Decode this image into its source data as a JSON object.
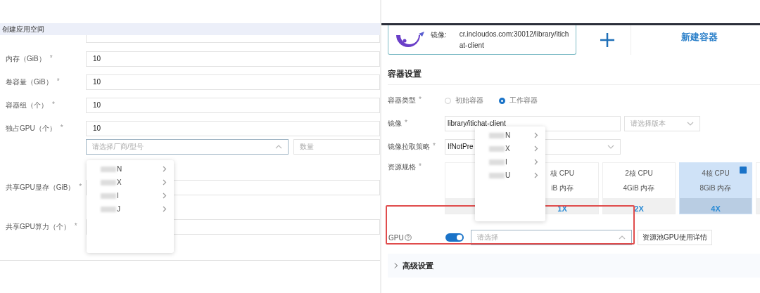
{
  "left": {
    "title": "创建应用空间",
    "fields": [
      {
        "label": "内存（GiB）",
        "asterisk": "*",
        "value": "10"
      },
      {
        "label": "卷容量（GiB）",
        "asterisk": "*",
        "value": "10"
      },
      {
        "label": "容器组（个）",
        "asterisk": "*",
        "value": "10"
      },
      {
        "label": "独占GPU（个）",
        "asterisk": "*",
        "value": "10"
      }
    ],
    "vendor_select": {
      "placeholder": "请选择厂商/型号",
      "expanded": true
    },
    "count_select": {
      "placeholder": "数量"
    },
    "vendor_menu": [
      {
        "label": "N"
      },
      {
        "label": "X"
      },
      {
        "label": "I"
      },
      {
        "label": "J"
      }
    ],
    "shared_fields": [
      {
        "label": "共享GPU显存（GiB）",
        "asterisk": "*"
      },
      {
        "label": "共享GPU算力（个）",
        "asterisk": "*"
      }
    ]
  },
  "right": {
    "image_card": {
      "label": "镜像:",
      "value_lines": [
        "cr.incloudos.com:30012/library/itich",
        "at-client"
      ]
    },
    "new_container": "新建容器",
    "section_title": "容器设置",
    "container_type": {
      "label": "容器类型",
      "asterisk": "*",
      "options": [
        {
          "label": "初始容器",
          "selected": false
        },
        {
          "label": "工作容器",
          "selected": true
        }
      ]
    },
    "image": {
      "label": "镜像",
      "asterisk": "*",
      "value": "library/itichat-client",
      "version_placeholder": "请选择版本"
    },
    "pull_policy": {
      "label": "镜像拉取策略",
      "asterisk": "*",
      "value": "IfNotPre"
    },
    "spec": {
      "label": "资源规格",
      "asterisk": "*",
      "cards": [
        {
          "selected": false
        },
        {
          "cpu": "核 CPU",
          "memory": "iB 内存",
          "multiplier": "1X",
          "selected": false
        },
        {
          "cpu": "2核 CPU",
          "memory": "4GiB 内存",
          "multiplier": "2X",
          "selected": false
        },
        {
          "cpu": "4核 CPU",
          "memory": "8GiB 内存",
          "multiplier": "4X",
          "selected": true
        },
        {
          "selected": false
        }
      ]
    },
    "gpu": {
      "label": "GPU",
      "on": true,
      "placeholder": "请选择",
      "expanded": true,
      "button": "资源池GPU使用详情"
    },
    "advanced": {
      "label": "高级设置",
      "expanded": false
    },
    "vendor_menu": [
      {
        "label": "N"
      },
      {
        "label": "X"
      },
      {
        "label": "I"
      },
      {
        "label": "U"
      }
    ]
  }
}
